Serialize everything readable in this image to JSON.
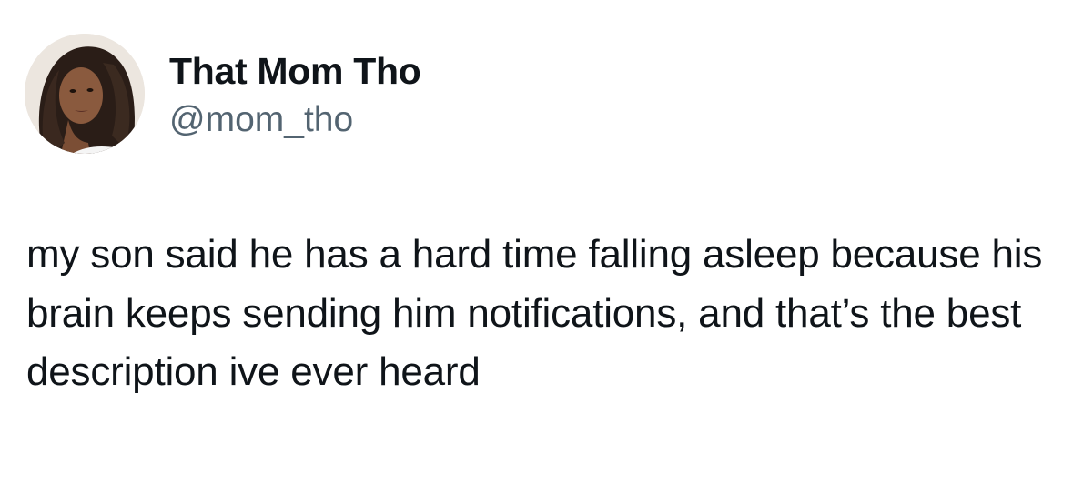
{
  "author": {
    "display_name": "That Mom Tho",
    "handle": "@mom_tho",
    "avatar_icon": "profile-photo-avatar"
  },
  "tweet": {
    "text": "my son said he has a hard time falling asleep because his brain keeps sending him notifications, and that’s the best description ive ever heard"
  },
  "colors": {
    "primary_text": "#0f1419",
    "secondary_text": "#536471",
    "background": "#ffffff"
  }
}
